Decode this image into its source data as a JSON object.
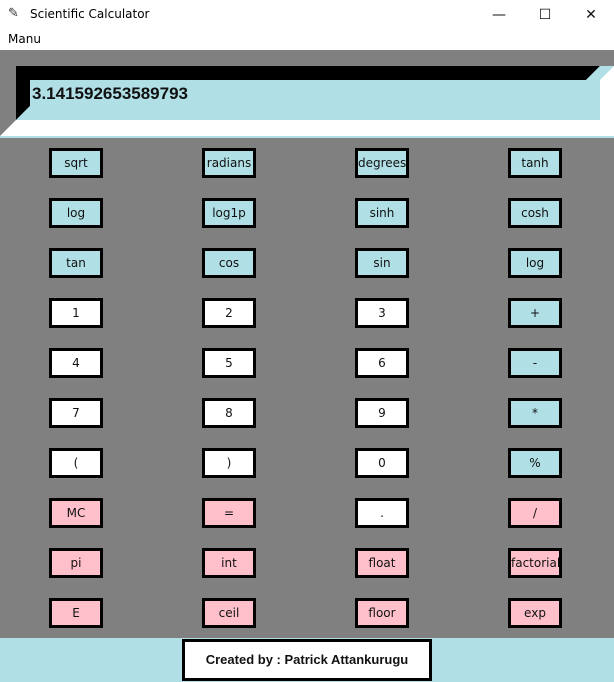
{
  "window": {
    "title": "Scientific Calculator",
    "icon": "feather-icon",
    "controls": {
      "minimize": "—",
      "maximize": "☐",
      "close": "✕"
    }
  },
  "menu": {
    "items": [
      "Manu"
    ]
  },
  "display": {
    "value": "3.141592653589793"
  },
  "keypad": {
    "rows": [
      [
        {
          "label": "sqrt",
          "color": "blue"
        },
        {
          "label": "radians",
          "color": "blue"
        },
        {
          "label": "degrees",
          "color": "blue"
        },
        {
          "label": "tanh",
          "color": "blue"
        }
      ],
      [
        {
          "label": "log",
          "color": "blue"
        },
        {
          "label": "log1p",
          "color": "blue"
        },
        {
          "label": "sinh",
          "color": "blue"
        },
        {
          "label": "cosh",
          "color": "blue"
        }
      ],
      [
        {
          "label": "tan",
          "color": "blue"
        },
        {
          "label": "cos",
          "color": "blue"
        },
        {
          "label": "sin",
          "color": "blue"
        },
        {
          "label": "log",
          "color": "blue"
        }
      ],
      [
        {
          "label": "1",
          "color": "white"
        },
        {
          "label": "2",
          "color": "white"
        },
        {
          "label": "3",
          "color": "white"
        },
        {
          "label": "+",
          "color": "blue"
        }
      ],
      [
        {
          "label": "4",
          "color": "white"
        },
        {
          "label": "5",
          "color": "white"
        },
        {
          "label": "6",
          "color": "white"
        },
        {
          "label": "-",
          "color": "blue"
        }
      ],
      [
        {
          "label": "7",
          "color": "white"
        },
        {
          "label": "8",
          "color": "white"
        },
        {
          "label": "9",
          "color": "white"
        },
        {
          "label": "*",
          "color": "blue"
        }
      ],
      [
        {
          "label": "(",
          "color": "white"
        },
        {
          "label": ")",
          "color": "white"
        },
        {
          "label": "0",
          "color": "white"
        },
        {
          "label": "%",
          "color": "blue"
        }
      ],
      [
        {
          "label": "MC",
          "color": "pink"
        },
        {
          "label": "=",
          "color": "pink"
        },
        {
          "label": ".",
          "color": "white"
        },
        {
          "label": "/",
          "color": "pink"
        }
      ],
      [
        {
          "label": "pi",
          "color": "pink"
        },
        {
          "label": "int",
          "color": "pink"
        },
        {
          "label": "float",
          "color": "pink"
        },
        {
          "label": "factorial",
          "color": "pink"
        }
      ],
      [
        {
          "label": "E",
          "color": "pink"
        },
        {
          "label": "ceil",
          "color": "pink"
        },
        {
          "label": "floor",
          "color": "pink"
        },
        {
          "label": "exp",
          "color": "pink"
        }
      ]
    ]
  },
  "footer": {
    "credit": "Created by : Patrick Attankurugu"
  },
  "colors": {
    "blue": "#b0dfe5",
    "white": "#ffffff",
    "pink": "#ffc0cb",
    "panel_grey": "#808080",
    "border": "#000000"
  }
}
